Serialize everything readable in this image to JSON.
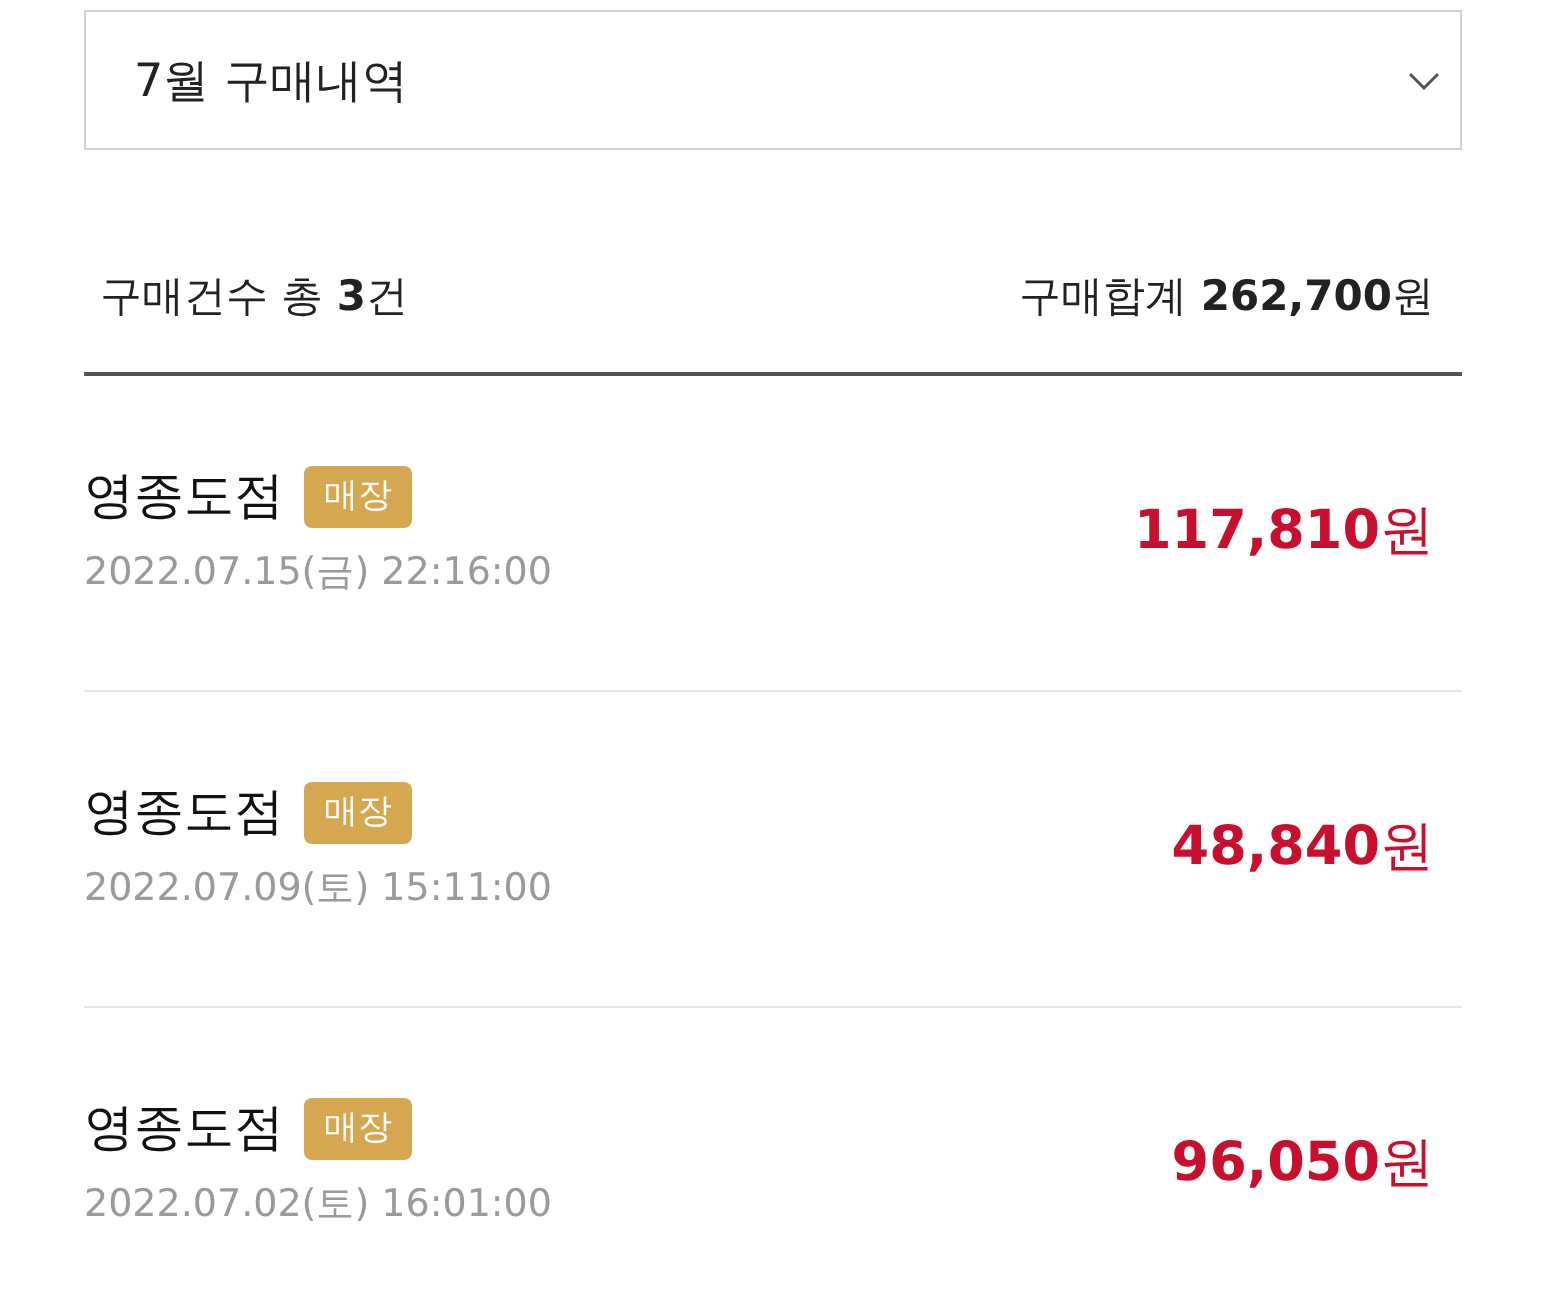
{
  "dropdown": {
    "value": "7월 구매내역"
  },
  "summary": {
    "count": "구매건수 총 **3**건",
    "total": "구매합계 **262,700**원"
  },
  "purchases": [
    {
      "store": "영종도점",
      "badge": "매장",
      "datetime": "2022.07.15(금) 22:16:00",
      "amount": "**117,810**원"
    },
    {
      "store": "영종도점",
      "badge": "매장",
      "datetime": "2022.07.09(토) 15:11:00",
      "amount": "**48,840**원"
    },
    {
      "store": "영종도점",
      "badge": "매장",
      "datetime": "2022.07.02(토) 16:01:00",
      "amount": "**96,050**원"
    }
  ]
}
